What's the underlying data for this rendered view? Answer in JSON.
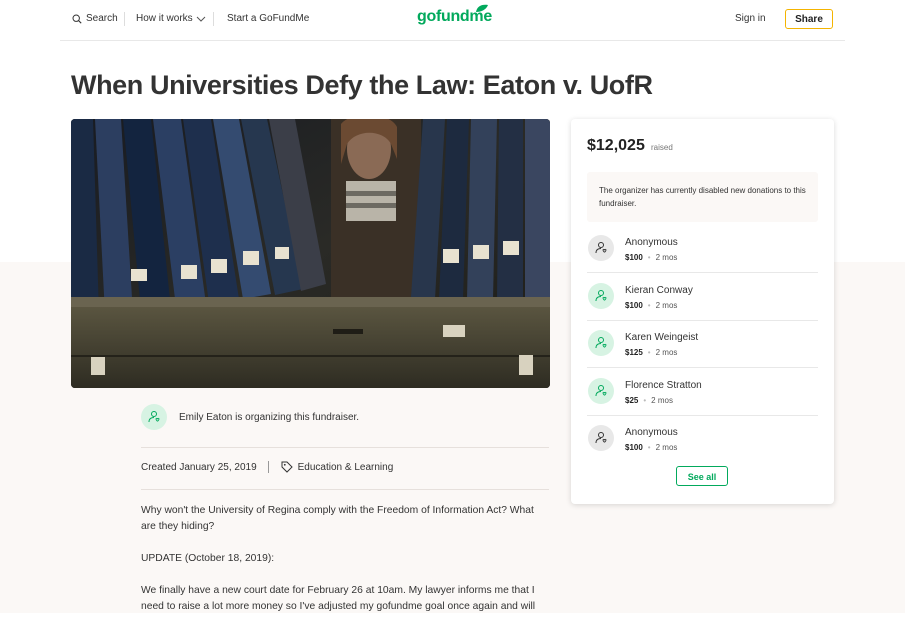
{
  "header": {
    "search_label": "Search",
    "how_it_works_label": "How it works",
    "start_label": "Start a GoFundMe",
    "logo_text": "gofundme",
    "signin_label": "Sign in",
    "share_label": "Share"
  },
  "campaign": {
    "title": "When Universities Defy the Law: Eaton v. UofR",
    "organizer_text": "Emily Eaton is organizing this fundraiser.",
    "created": "Created January 25, 2019",
    "category": "Education & Learning",
    "story": [
      "Why won't the University of Regina comply with the Freedom of Information Act? What are they hiding?",
      "UPDATE (October 18, 2019):",
      "We finally have a new court date for February 26 at 10am.  My lawyer informs me that I need to raise a lot more money so I've adjusted my gofundme goal once again and will"
    ]
  },
  "donation_card": {
    "raised_amount": "$12,025",
    "raised_label": "raised",
    "notice": "The organizer has currently disabled new donations to this fundraiser.",
    "donations": [
      {
        "name": "Anonymous",
        "amount": "$100",
        "time": "2 mos",
        "avatar": "gray"
      },
      {
        "name": "Kieran Conway",
        "amount": "$100",
        "time": "2 mos",
        "avatar": "green"
      },
      {
        "name": "Karen Weingeist",
        "amount": "$125",
        "time": "2 mos",
        "avatar": "green"
      },
      {
        "name": "Florence Stratton",
        "amount": "$25",
        "time": "2 mos",
        "avatar": "green"
      },
      {
        "name": "Anonymous",
        "amount": "$100",
        "time": "2 mos",
        "avatar": "gray"
      }
    ],
    "see_all_label": "See all"
  },
  "colors": {
    "brand_green": "#02a95c",
    "share_border": "#f4b400",
    "beige_background": "#fbf8f6"
  },
  "icons": [
    "search-icon",
    "chevron-down-icon",
    "tag-icon",
    "user-heart-icon"
  ]
}
